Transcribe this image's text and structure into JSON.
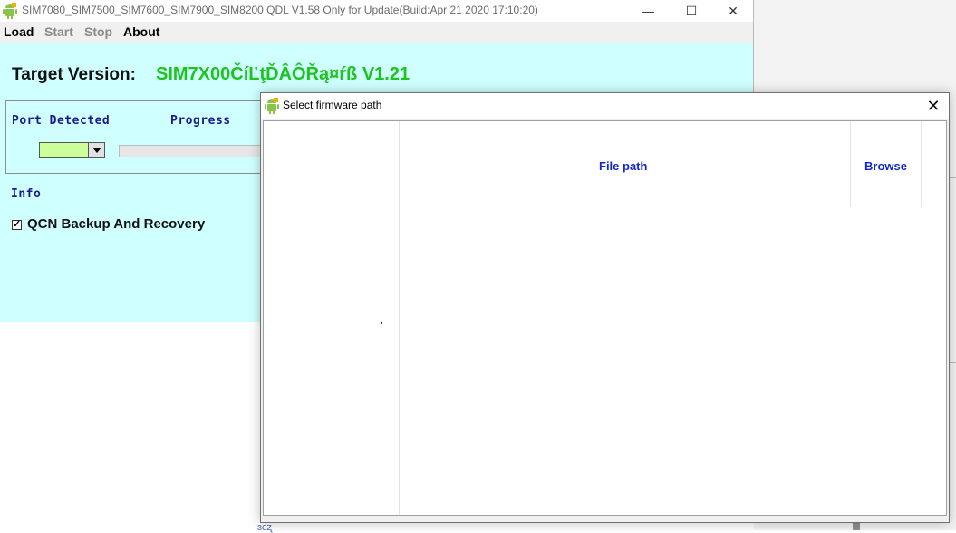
{
  "main_window": {
    "title": "SIM7080_SIM7500_SIM7600_SIM7900_SIM8200 QDL V1.58 Only for Update(Build:Apr 21 2020 17:10:20)",
    "menu": [
      {
        "label": "Load",
        "enabled": true
      },
      {
        "label": "Start",
        "enabled": false
      },
      {
        "label": "Stop",
        "enabled": false
      },
      {
        "label": "About",
        "enabled": true
      }
    ],
    "target_version_label": "Target Version:",
    "target_version_value": "SIM7X00ČíĽţĎÂÔŘą¤ŕß V1.21",
    "port_detected_label": "Port Detected",
    "progress_label": "Progress",
    "progress_value": 0,
    "info_label": "Info",
    "qcn_checkbox_label": "QCN Backup And Recovery",
    "qcn_checked": true,
    "check_mark": "✓"
  },
  "dialog": {
    "title": "Select firmware path",
    "columns": {
      "file_path": "File path",
      "browse": "Browse"
    }
  },
  "window_controls": {
    "minimize": "—",
    "maximize": "☐",
    "close": "✕"
  },
  "background": {
    "bottom_fragment_text": "ɜᴄʐ"
  },
  "colors": {
    "app_background": "#cfffff",
    "target_value": "#1ec41e",
    "label_blue": "#1a1a8c",
    "header_blue": "#1428c8",
    "port_combo": "#ccff99"
  }
}
